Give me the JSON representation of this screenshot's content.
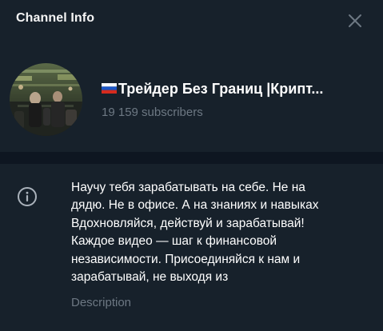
{
  "header": {
    "title": "Channel Info",
    "close_icon": "close-icon"
  },
  "channel": {
    "flag_icon": "russian-flag-icon",
    "name": "Трейдер Без Границ |Крипт...",
    "subscribers": "19 159 subscribers"
  },
  "info": {
    "icon": "info-icon",
    "description_lines": [
      "Научу тебя зарабатывать на себе. Не на",
      "дядю. Не в  офисе. А на знаниях и навыках",
      "Вдохновляйся, действуй и зарабатывай!",
      "Каждое видео — шаг к финансовой",
      "независимости. Присоединяйся к нам и",
      "зарабатывай, не выходя из"
    ],
    "label": "Description"
  },
  "colors": {
    "panel_bg": "#17212b",
    "divider_bg": "#0e1621",
    "secondary_text": "#6d7883",
    "icon": "#aab2bb"
  }
}
